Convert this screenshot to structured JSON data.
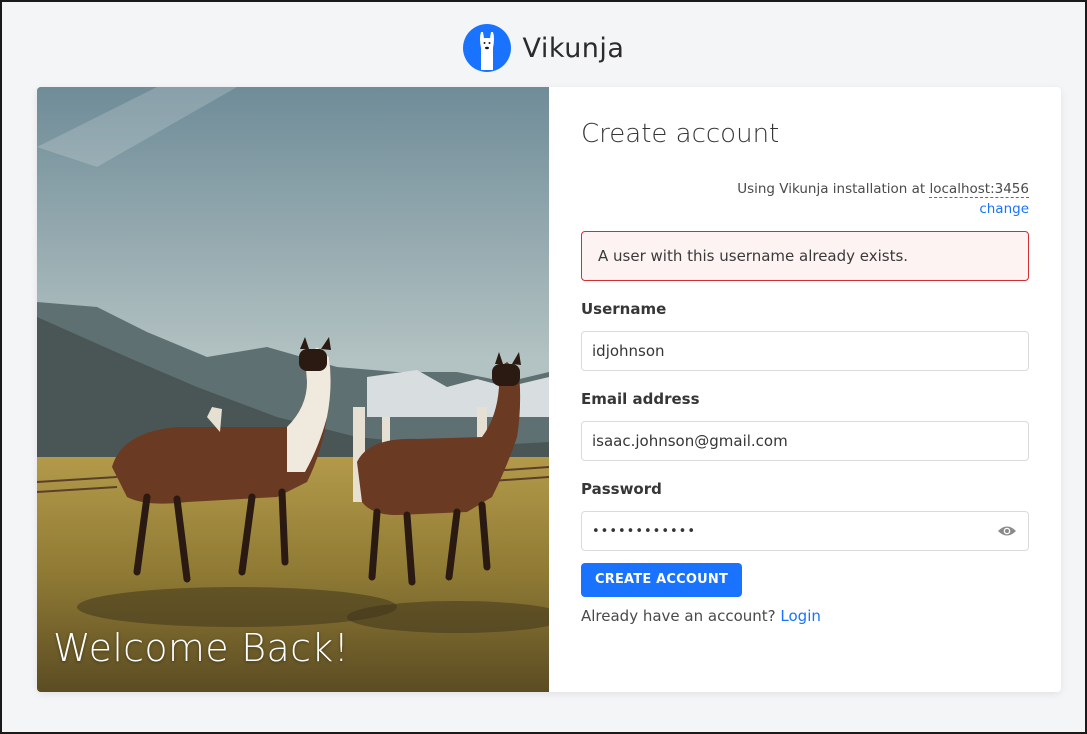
{
  "brand": {
    "name": "Vikunja",
    "accent": "#1973ff"
  },
  "hero": {
    "welcome_text": "Welcome Back!"
  },
  "form": {
    "title": "Create account",
    "install": {
      "prefix": "Using Vikunja installation at",
      "host": "localhost:3456",
      "change": "change"
    },
    "error": "A user with this username already exists.",
    "fields": {
      "username": {
        "label": "Username",
        "value": "idjohnson"
      },
      "email": {
        "label": "Email address",
        "value": "isaac.johnson@gmail.com"
      },
      "password": {
        "label": "Password",
        "value": "••••••••••••"
      }
    },
    "submit_label": "CREATE ACCOUNT",
    "footer": {
      "text": "Already have an account?",
      "login": "Login"
    }
  }
}
